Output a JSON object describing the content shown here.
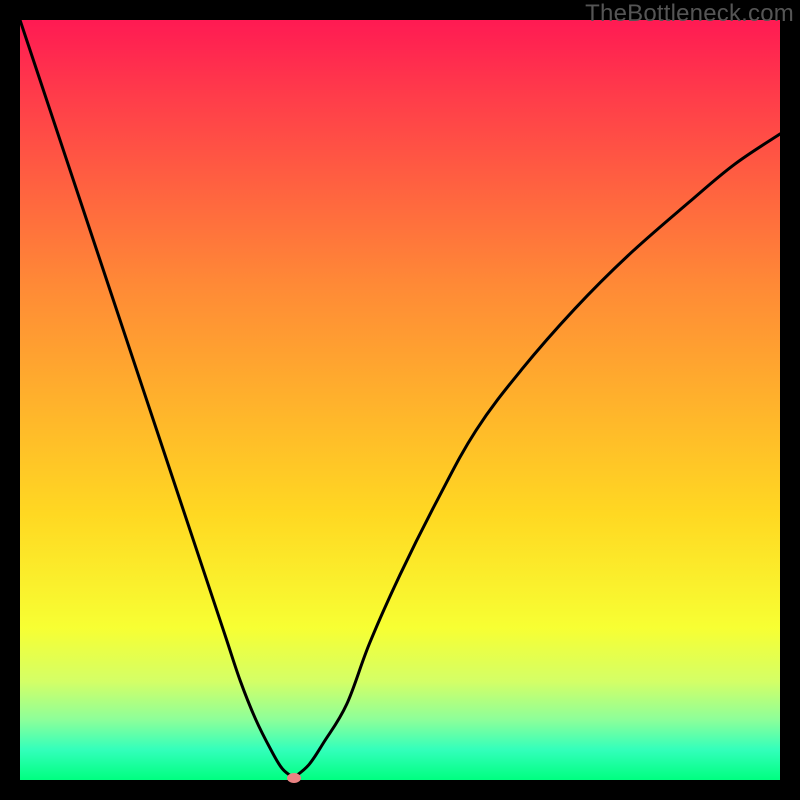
{
  "watermark": "TheBottleneck.com",
  "colors": {
    "frame_bg_top": "#ff1a53",
    "frame_bg_bottom": "#00ff80",
    "border": "#000000",
    "curve": "#000000",
    "marker": "#e98282"
  },
  "chart_data": {
    "type": "line",
    "title": "",
    "xlabel": "",
    "ylabel": "",
    "xlim": [
      0,
      100
    ],
    "ylim": [
      0,
      100
    ],
    "grid": false,
    "legend": false,
    "series": [
      {
        "name": "left-branch",
        "x": [
          0,
          4,
          8,
          12,
          16,
          20,
          24,
          27,
          29,
          31,
          33,
          34.5,
          36
        ],
        "y": [
          100,
          88,
          76,
          64,
          52,
          40,
          28,
          19,
          13,
          8,
          4,
          1.5,
          0.3
        ]
      },
      {
        "name": "right-branch",
        "x": [
          36,
          38,
          40,
          43,
          46,
          50,
          55,
          60,
          66,
          73,
          80,
          88,
          94,
          100
        ],
        "y": [
          0.3,
          2,
          5,
          10,
          18,
          27,
          37,
          46,
          54,
          62,
          69,
          76,
          81,
          85
        ]
      }
    ],
    "marker": {
      "x": 36,
      "y": 0.3
    },
    "annotations": []
  }
}
